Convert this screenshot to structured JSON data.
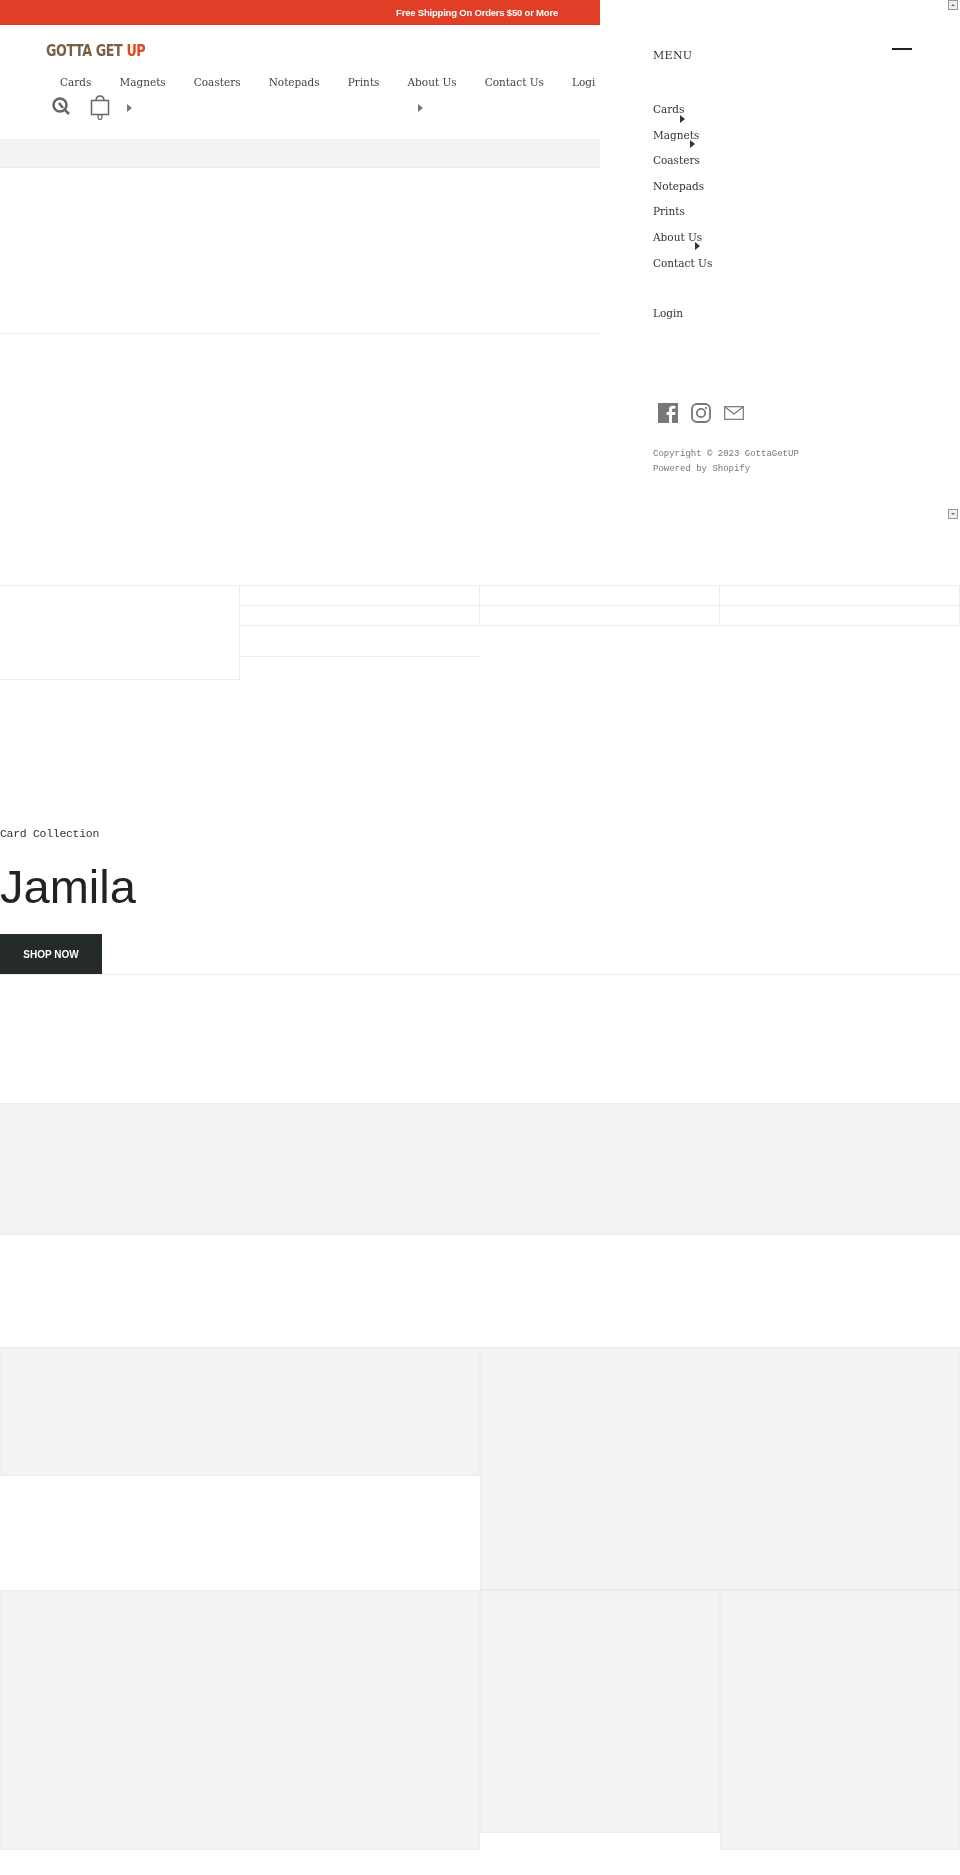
{
  "announcement": "Free Shipping On Orders $50 or More",
  "logo": {
    "text": "GOTTA GET",
    "accent": "UP"
  },
  "nav": [
    "Cards",
    "Magnets",
    "Coasters",
    "Notepads",
    "Prints",
    "About Us",
    "Contact Us",
    "Logi"
  ],
  "hero": {
    "eyebrow": "Card Collection",
    "title": "Jamila",
    "button": "SHOP NOW"
  },
  "drawer": {
    "title": "MENU",
    "items": [
      {
        "label": "Cards",
        "submenu": true
      },
      {
        "label": "Magnets",
        "submenu": true
      },
      {
        "label": "Coasters",
        "submenu": false
      },
      {
        "label": "Notepads",
        "submenu": false
      },
      {
        "label": "Prints",
        "submenu": false
      },
      {
        "label": "About Us",
        "submenu": true
      },
      {
        "label": "Contact Us",
        "submenu": false
      }
    ],
    "login": "Login",
    "copyright": "Copyright © 2023 GottaGetUP",
    "powered": "Powered by Shopify"
  }
}
